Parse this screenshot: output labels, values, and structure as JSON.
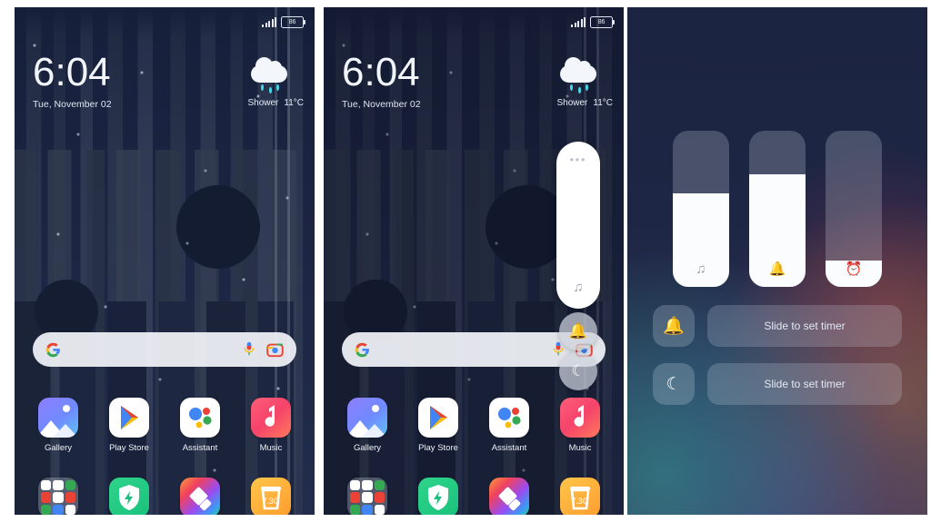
{
  "panels": {
    "home": {
      "status": {
        "battery": "86",
        "signal_icon": "signal-bars-icon",
        "battery_icon": "battery-icon"
      },
      "clock": {
        "time": "6:04",
        "date": "Tue, November 02"
      },
      "weather": {
        "icon": "shower-cloud-icon",
        "condition": "Shower",
        "temperature": "11°C"
      },
      "search": {
        "google_icon": "google-g-icon",
        "mic_icon": "microphone-icon",
        "lens_icon": "google-lens-icon",
        "placeholder": ""
      },
      "apps_row1": [
        {
          "label": "Gallery",
          "icon": "gallery-icon"
        },
        {
          "label": "Play Store",
          "icon": "play-store-icon"
        },
        {
          "label": "Assistant",
          "icon": "google-assistant-icon"
        },
        {
          "label": "Music",
          "icon": "music-icon"
        }
      ],
      "apps_row2": [
        {
          "label": "",
          "icon": "google-folder-icon"
        },
        {
          "label": "",
          "icon": "security-shield-icon"
        },
        {
          "label": "",
          "icon": "themes-brush-icon"
        },
        {
          "label": "",
          "icon": "cleaner-trash-icon",
          "badge": "7.3G"
        }
      ]
    },
    "volume_popup": {
      "status": {
        "battery": "86"
      },
      "clock": {
        "time": "6:04",
        "date": "Tue, November 02"
      },
      "weather": {
        "condition": "Shower",
        "temperature": "11°C"
      },
      "card": {
        "expand_icon": "more-options-dots-icon",
        "stream_icon": "music-note-icon",
        "level_percent": 100
      },
      "quick_buttons": [
        {
          "icon": "bell-icon",
          "name": "ring-mode-button"
        },
        {
          "icon": "moon-icon",
          "name": "do-not-disturb-button"
        }
      ]
    },
    "sound_settings": {
      "sliders": [
        {
          "name": "media-volume-slider",
          "icon": "music-note-icon",
          "level_percent": 60
        },
        {
          "name": "ring-volume-slider",
          "icon": "bell-icon",
          "level_percent": 72
        },
        {
          "name": "alarm-volume-slider",
          "icon": "alarm-clock-icon",
          "level_percent": 17
        }
      ],
      "timers": [
        {
          "name": "silent-timer-row",
          "icon": "bell-icon",
          "label": "Slide to set timer"
        },
        {
          "name": "dnd-timer-row",
          "icon": "moon-icon",
          "label": "Slide to set timer"
        }
      ]
    }
  },
  "colors": {
    "wallpaper_navy": "#1b2440",
    "card_white": "#ffffff",
    "accent_teal": "#46d8e8",
    "music_red": "#f5436a",
    "security_green": "#19c27c"
  }
}
